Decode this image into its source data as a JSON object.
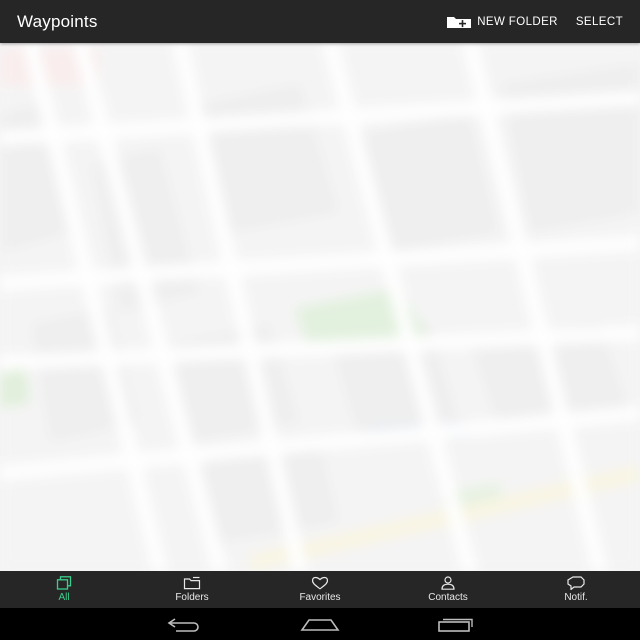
{
  "appbar": {
    "title": "Waypoints",
    "new_folder_label": "NEW FOLDER",
    "select_label": "SELECT",
    "new_folder_icon": "folder-plus-icon"
  },
  "map": {
    "state": "blurred background map"
  },
  "bottom_nav": {
    "accent_color": "#3ccf8e",
    "tabs": [
      {
        "label": "All",
        "icon": "stacked-squares-icon",
        "active": true
      },
      {
        "label": "Folders",
        "icon": "folder-icon",
        "active": false
      },
      {
        "label": "Favorites",
        "icon": "heart-icon",
        "active": false
      },
      {
        "label": "Contacts",
        "icon": "person-icon",
        "active": false
      },
      {
        "label": "Notif.",
        "icon": "speech-bubble-icon",
        "active": false
      }
    ]
  },
  "system_nav": {
    "buttons": [
      "back-icon",
      "home-icon",
      "recents-icon"
    ]
  }
}
